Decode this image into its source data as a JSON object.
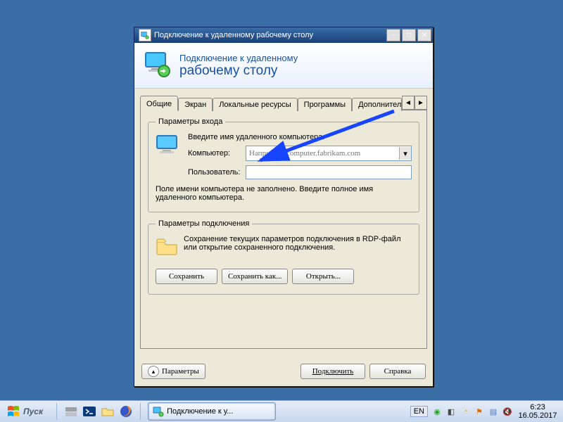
{
  "titlebar": {
    "title": "Подключение к удаленному рабочему столу"
  },
  "banner": {
    "line1": "Подключение к удаленному",
    "line2": "рабочему столу"
  },
  "tabs": {
    "items": [
      {
        "label": "Общие",
        "selected": true
      },
      {
        "label": "Экран"
      },
      {
        "label": "Локальные ресурсы"
      },
      {
        "label": "Программы"
      },
      {
        "label": "Дополнительн"
      }
    ]
  },
  "group_login": {
    "legend": "Параметры входа",
    "intro": "Введите имя удаленного компьютера.",
    "computer_label": "Компьютер:",
    "computer_placeholder": "Например: computer.fabrikam.com",
    "computer_value": "",
    "user_label": "Пользователь:",
    "user_value": "",
    "hint": "Поле имени компьютера не заполнено. Введите полное имя удаленного компьютера."
  },
  "group_conn": {
    "legend": "Параметры подключения",
    "desc": "Сохранение текущих параметров подключения в RDP-файл или открытие сохраненного подключения.",
    "save": "Сохранить",
    "save_as": "Сохранить как...",
    "open": "Открыть..."
  },
  "footer": {
    "options": "Параметры",
    "connect": "Подключить",
    "help": "Справка"
  },
  "taskbar": {
    "start": "Пуск",
    "active_task": "Подключение к у...",
    "lang": "EN",
    "time": "6:23",
    "date": "16.05.2017"
  }
}
